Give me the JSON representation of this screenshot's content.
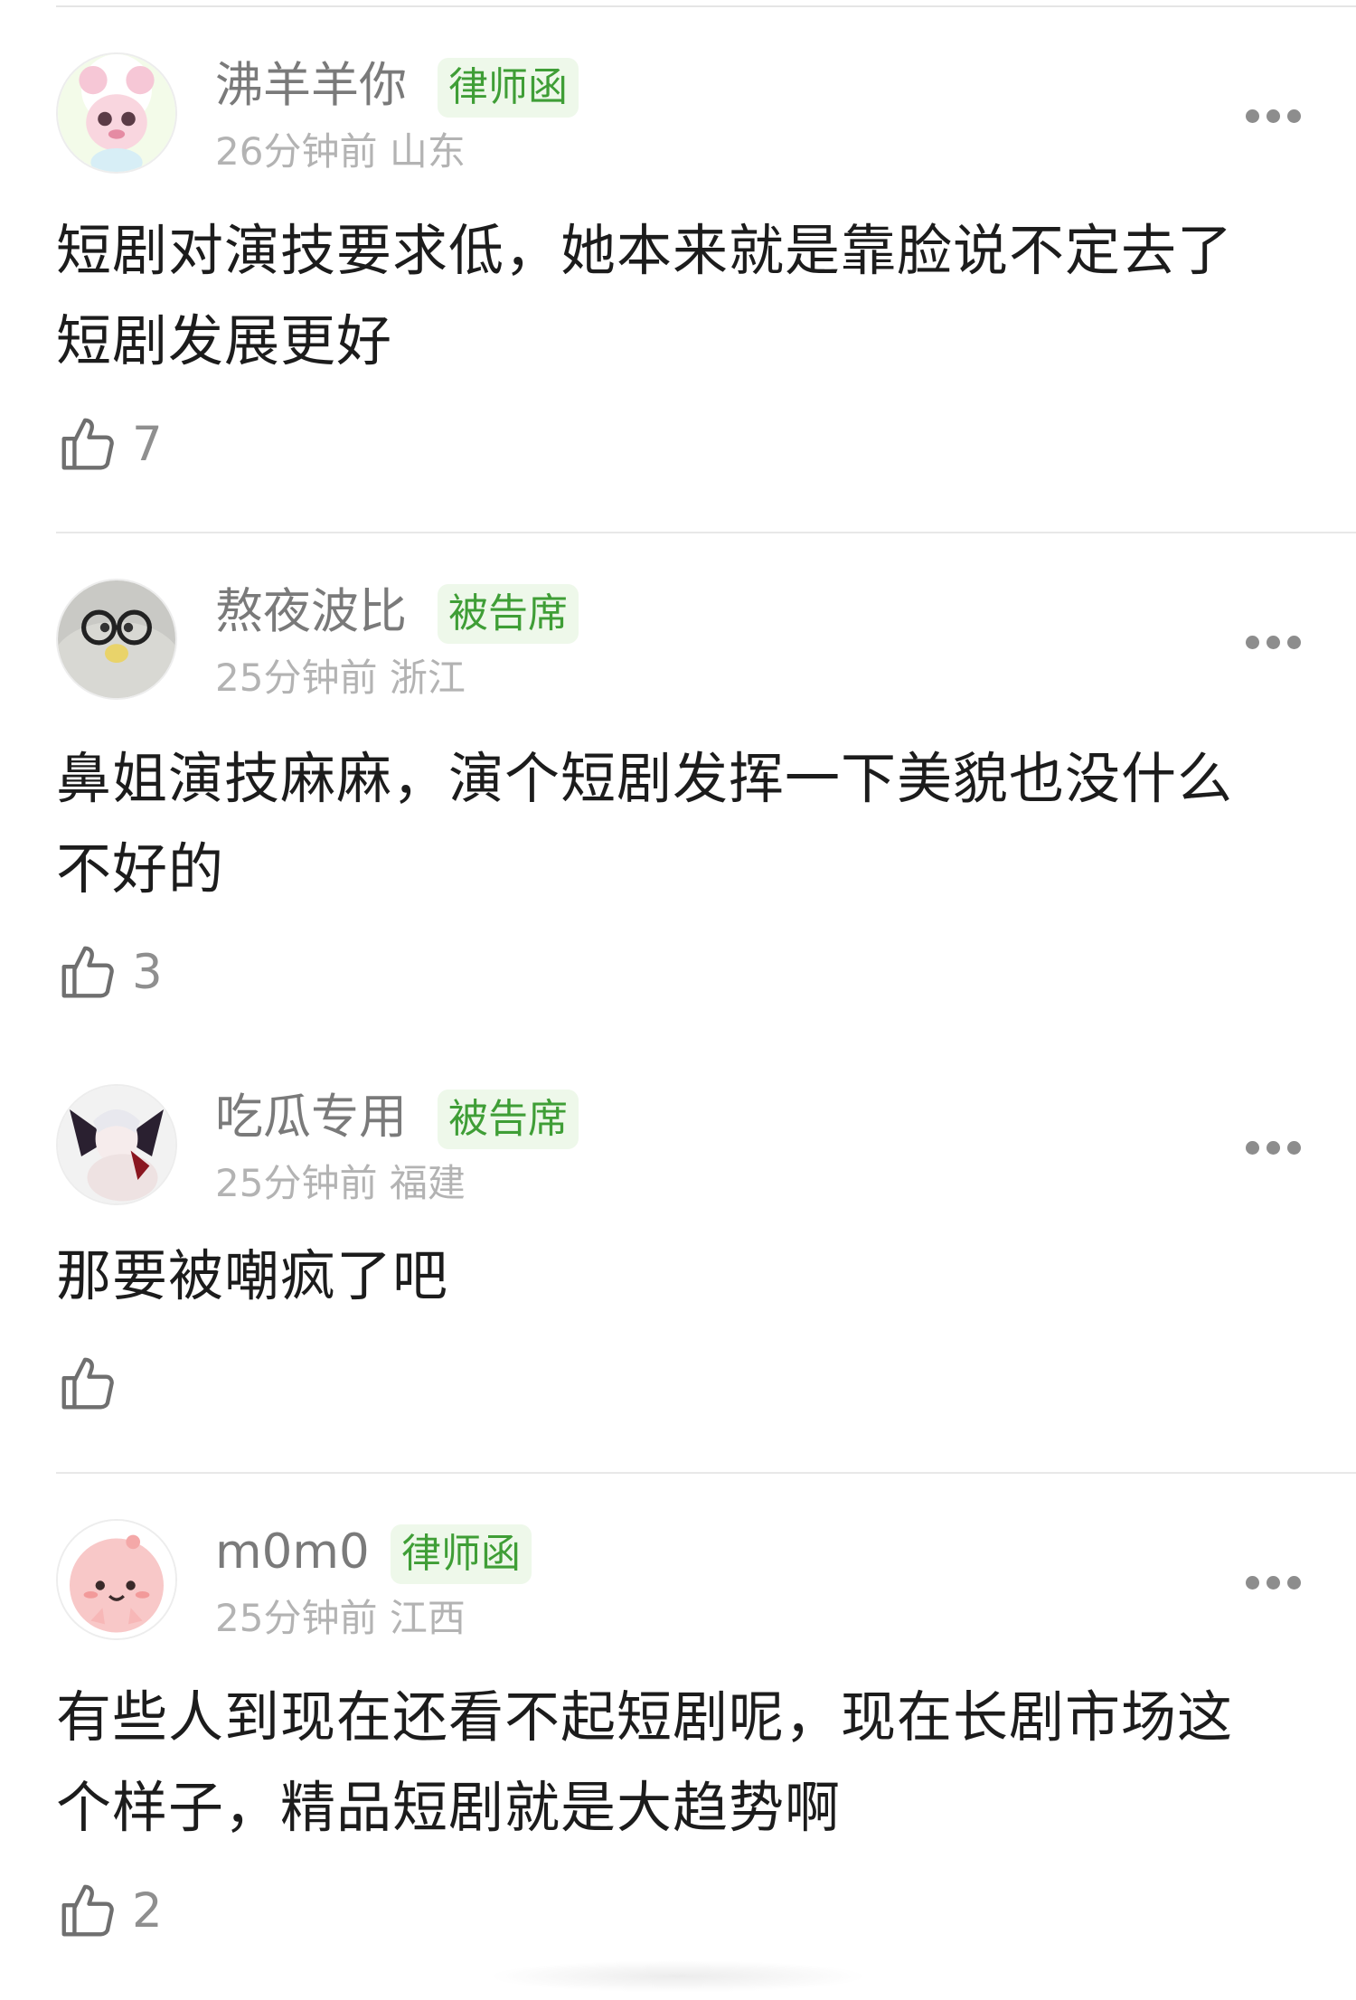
{
  "comments": [
    {
      "username": "沸羊羊你",
      "badge": "律师函",
      "time": "26分钟前",
      "location": "山东",
      "text": "短剧对演技要求低，她本来就是靠脸说不定去了短剧发展更好",
      "likes": "7",
      "avatar_icon": "pink-sheep-avatar"
    },
    {
      "username": "熬夜波比",
      "badge": "被告席",
      "time": "25分钟前",
      "location": "浙江",
      "text": "鼻姐演技麻麻，演个短剧发挥一下美貌也没什么不好的",
      "likes": "3",
      "avatar_icon": "glasses-avatar"
    },
    {
      "username": "吃瓜专用",
      "badge": "被告席",
      "time": "25分钟前",
      "location": "福建",
      "text": "那要被嘲疯了吧",
      "likes": "",
      "avatar_icon": "anime-character-avatar"
    },
    {
      "username": "m0m0",
      "badge": "律师函",
      "time": "25分钟前",
      "location": "江西",
      "text": "有些人到现在还看不起短剧呢，现在长剧市场这个样子，精品短剧就是大趋势啊",
      "likes": "2",
      "avatar_icon": "pink-blob-avatar"
    }
  ],
  "colors": {
    "badge_bg": "#eef8ea",
    "badge_text": "#3f9e36",
    "username": "#7a7a7a",
    "meta": "#b3b3b3"
  }
}
